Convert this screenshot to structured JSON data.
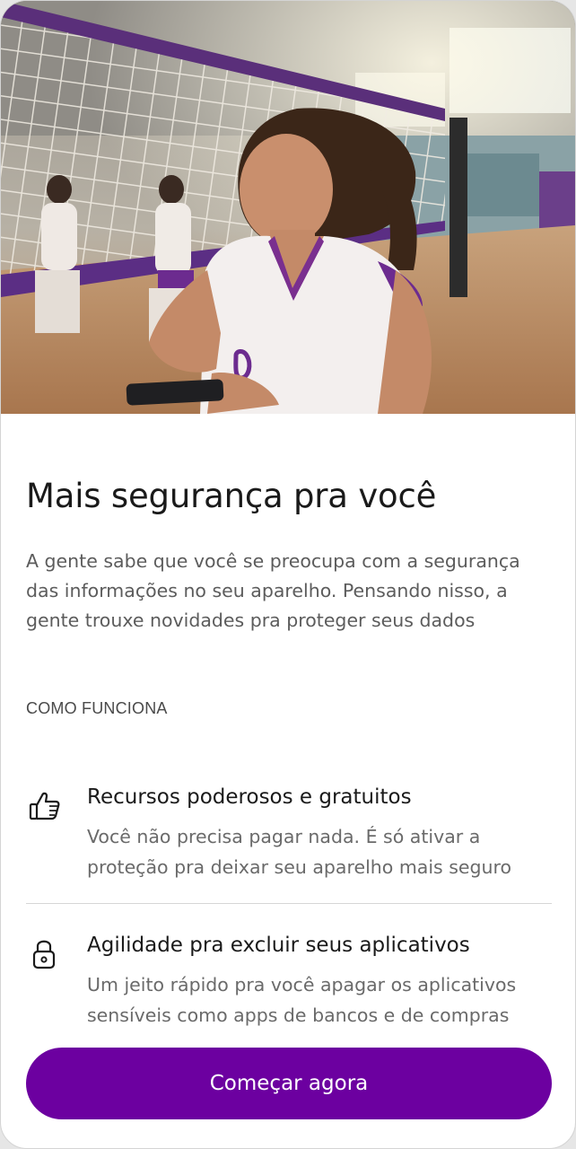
{
  "hero": {
    "image": "volleyball-player-with-phone-photo"
  },
  "title": "Mais segurança pra você",
  "lead": "A gente sabe que você se preocupa com a segurança das informações no seu aparelho. Pensando nisso, a gente trouxe novidades pra proteger seus dados",
  "section_label": "COMO FUNCIONA",
  "features": [
    {
      "icon": "thumbs-up-icon",
      "title": "Recursos poderosos e gratuitos",
      "description": "Você não precisa pagar nada. É só ativar a proteção pra deixar seu aparelho mais seguro"
    },
    {
      "icon": "lock-icon",
      "title": "Agilidade pra excluir seus aplicativos",
      "description": "Um jeito rápido pra você apagar os aplicativos sensíveis como apps de bancos e de compras"
    }
  ],
  "cta": {
    "label": "Começar agora"
  },
  "colors": {
    "brand": "#6c00a0",
    "title": "#1a1a1a",
    "body": "#5c5c5c"
  }
}
